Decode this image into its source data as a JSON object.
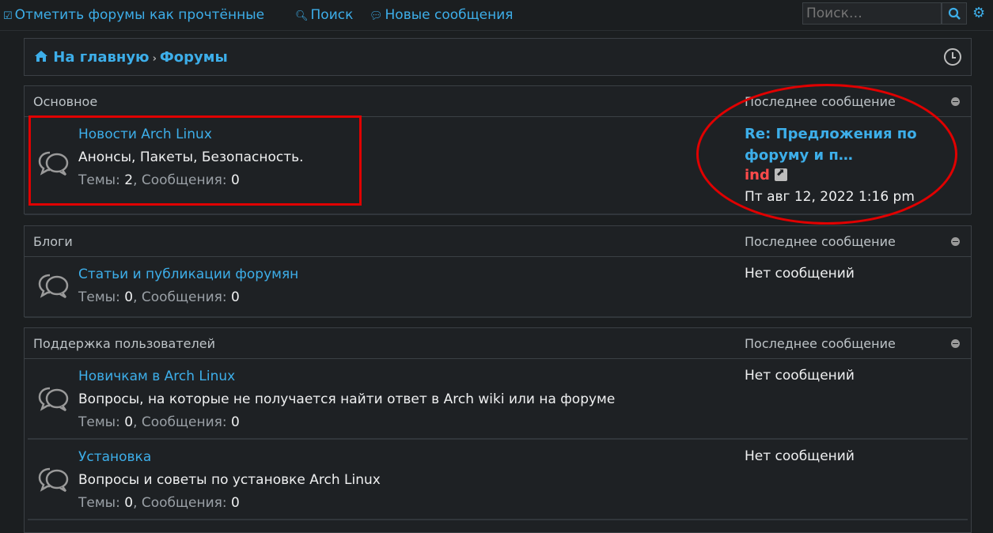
{
  "topnav": {
    "mark_read": "Отметить форумы как прочтённые",
    "search": "Поиск",
    "new_posts": "Новые сообщения",
    "search_placeholder": "Поиск…"
  },
  "breadcrumb": {
    "home": "На главную",
    "forums": "Форумы"
  },
  "categories": [
    {
      "name": "Основное",
      "last_label": "Последнее сообщение",
      "forums": [
        {
          "title": "Новости Arch Linux",
          "desc": "Анонсы, Пакеты, Безопасность.",
          "topics_label": "Темы:",
          "topics": "2",
          "posts_label": "Сообщения:",
          "posts": "0",
          "last_title": "Re: Предложения по форуму и п…",
          "last_user": "ind",
          "last_date": "Пт авг 12, 2022 1:16 pm"
        }
      ]
    },
    {
      "name": "Блоги",
      "last_label": "Последнее сообщение",
      "forums": [
        {
          "title": "Статьи и публикации форумян",
          "topics_label": "Темы:",
          "topics": "0",
          "posts_label": "Сообщения:",
          "posts": "0",
          "no_posts": "Нет сообщений"
        }
      ]
    },
    {
      "name": "Поддержка пользователей",
      "last_label": "Последнее сообщение",
      "forums": [
        {
          "title": "Новичкам в Arch Linux",
          "desc": "Вопросы, на которые не получается найти ответ в Arch wiki или на форуме",
          "topics_label": "Темы:",
          "topics": "0",
          "posts_label": "Сообщения:",
          "posts": "0",
          "no_posts": "Нет сообщений"
        },
        {
          "title": "Установка",
          "desc": "Вопросы и советы по установке Arch Linux",
          "topics_label": "Темы:",
          "topics": "0",
          "posts_label": "Сообщения:",
          "posts": "0",
          "no_posts": "Нет сообщений"
        }
      ]
    }
  ],
  "colors": {
    "link": "#3daee9",
    "username": "#ff4b4b",
    "annotation": "#e00000",
    "background": "#1b1e20"
  }
}
